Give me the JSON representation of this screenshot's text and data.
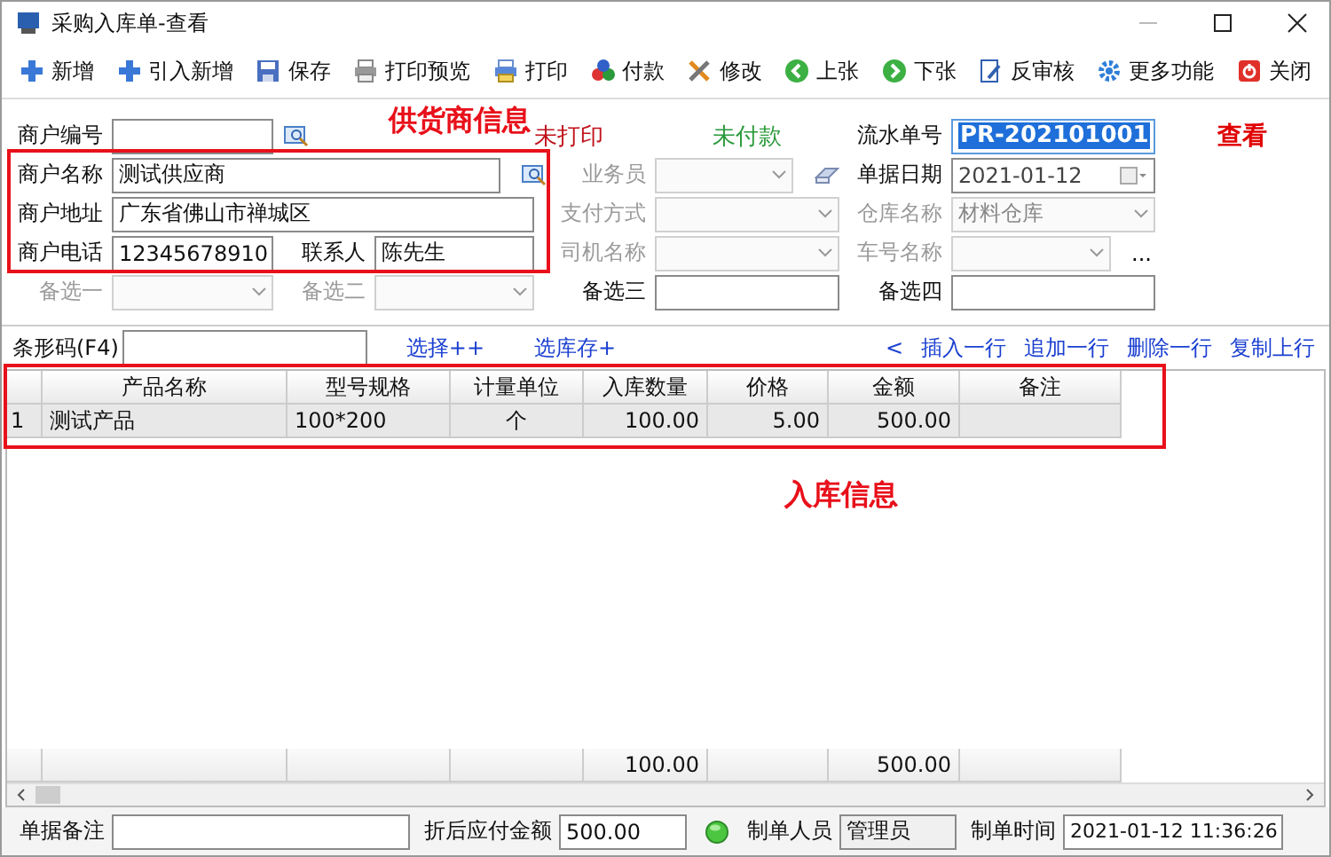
{
  "window": {
    "title": "采购入库单-查看"
  },
  "toolbar": [
    "新增",
    "引入新增",
    "保存",
    "打印预览",
    "打印",
    "付款",
    "修改",
    "上张",
    "下张",
    "反审核",
    "更多功能",
    "关闭"
  ],
  "annotations": {
    "supplier": "供货商信息",
    "stock": "入库信息"
  },
  "print_status": "未打印",
  "payment_status": "未付款",
  "mode": "查看",
  "header": {
    "supplier_code": {
      "label": "商户编号"
    },
    "supplier_name": {
      "label": "商户名称",
      "value": "测试供应商"
    },
    "supplier_address": {
      "label": "商户地址",
      "value": "广东省佛山市禅城区"
    },
    "supplier_phone": {
      "label": "商户电话",
      "value": "12345678910"
    },
    "contact": {
      "label": "联系人",
      "value": "陈先生"
    },
    "option_1": {
      "label": "备选一",
      "disabled": true
    },
    "option_2": {
      "label": "备选二",
      "disabled": true
    },
    "salesperson": {
      "label": "业务员",
      "disabled": true
    },
    "payment_method": {
      "label": "支付方式",
      "disabled": true
    },
    "driver": {
      "label": "司机名称",
      "disabled": true
    },
    "option_3": {
      "label": "备选三",
      "disabled": false
    },
    "serial_no": {
      "label": "流水单号",
      "value": "PR-202101001",
      "highlighted": true
    },
    "date": {
      "label": "单据日期",
      "value": "2021-01-12"
    },
    "warehouse": {
      "label": "仓库名称",
      "value": "材料仓库",
      "disabled": true
    },
    "vehicle": {
      "label": "车号名称",
      "disabled": true,
      "more": "..."
    },
    "option_4": {
      "label": "备选四",
      "disabled": false
    }
  },
  "barcode": {
    "label": "条形码(F4)"
  },
  "links_left": [
    "选择++",
    "选库存+"
  ],
  "collapse": "<",
  "links_right": [
    "插入一行",
    "追加一行",
    "删除一行",
    "复制上行"
  ],
  "table": {
    "columns": [
      "产品名称",
      "型号规格",
      "计量单位",
      "入库数量",
      "价格",
      "金额",
      "备注"
    ],
    "rows": [
      {
        "index": "1",
        "selected": true,
        "cells": [
          "测试产品",
          "100*200",
          "个",
          "100.00",
          "5.00",
          "500.00",
          null
        ]
      }
    ],
    "totals": {
      "quantity": "100.00",
      "amount": "500.00"
    }
  },
  "footer": {
    "remark": {
      "label": "单据备注"
    },
    "payable": {
      "label": "折后应付金额",
      "value": "500.00"
    },
    "creator": {
      "label": "制单人员",
      "value": "管理员"
    },
    "created_at": {
      "label": "制单时间",
      "value": "2021-01-12 11:36:26"
    }
  }
}
